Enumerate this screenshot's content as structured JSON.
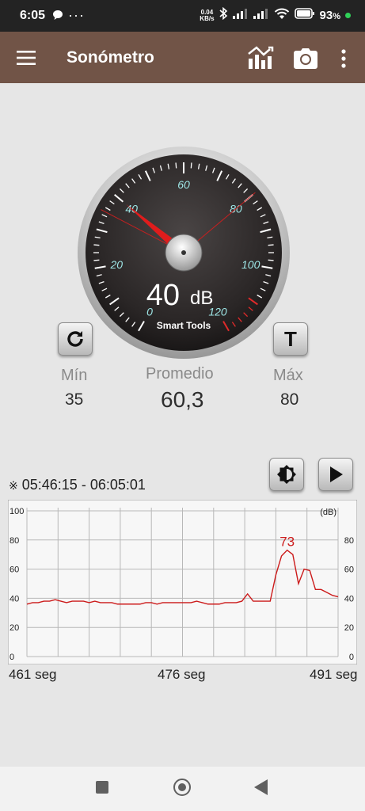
{
  "status": {
    "time": "6:05",
    "dots": "···",
    "kbs_top": "0.04",
    "kbs_bottom": "KB/s",
    "battery": "93",
    "battery_unit": "%"
  },
  "app": {
    "title": "Sonómetro"
  },
  "icons": {
    "menu": "menu-icon",
    "chart": "chart-icon",
    "camera": "camera-icon",
    "more": "more-vert-icon",
    "reset": "refresh-icon",
    "brightness": "brightness-icon",
    "play": "play-icon"
  },
  "gauge": {
    "value": "40",
    "unit": "dB",
    "brand": "Smart Tools",
    "needle_value": 40,
    "min_marker": 35,
    "max_marker": 80,
    "scale": [
      "0",
      "20",
      "40",
      "60",
      "80",
      "100",
      "120"
    ]
  },
  "buttons": {
    "t_label": "T"
  },
  "stats": {
    "min_label": "Mín",
    "min_value": "35",
    "avg_label": "Promedio",
    "avg_value": "60,3",
    "max_label": "Máx",
    "max_value": "80"
  },
  "history": {
    "symbol": "※",
    "range": "05:46:15 - 06:05:01",
    "unit": "(dB)",
    "yticks": [
      "0",
      "20",
      "40",
      "60",
      "80",
      "100"
    ],
    "peak_label": "73",
    "xlabels": [
      "461 seg",
      "476 seg",
      "491 seg"
    ]
  },
  "chart_data": {
    "type": "line",
    "ylim": [
      0,
      100
    ],
    "xlabel": "",
    "ylabel": "(dB)",
    "x_range": [
      461,
      491
    ],
    "series": [
      {
        "values": [
          36,
          37,
          37,
          38,
          38,
          39,
          38,
          37,
          38,
          38,
          38,
          37,
          38,
          37,
          37,
          37,
          36,
          36,
          36,
          36,
          36,
          37,
          37,
          36,
          37,
          37,
          37,
          37,
          37,
          37,
          38,
          37,
          36,
          36,
          36,
          37,
          37,
          37,
          38,
          43,
          38,
          38,
          38,
          38,
          56,
          69,
          73,
          70,
          50,
          60,
          59,
          46,
          46,
          44,
          42,
          41
        ]
      }
    ],
    "peak": 73,
    "colors": {
      "line": "#cc1b1b",
      "grid": "#b8b8b8"
    }
  }
}
